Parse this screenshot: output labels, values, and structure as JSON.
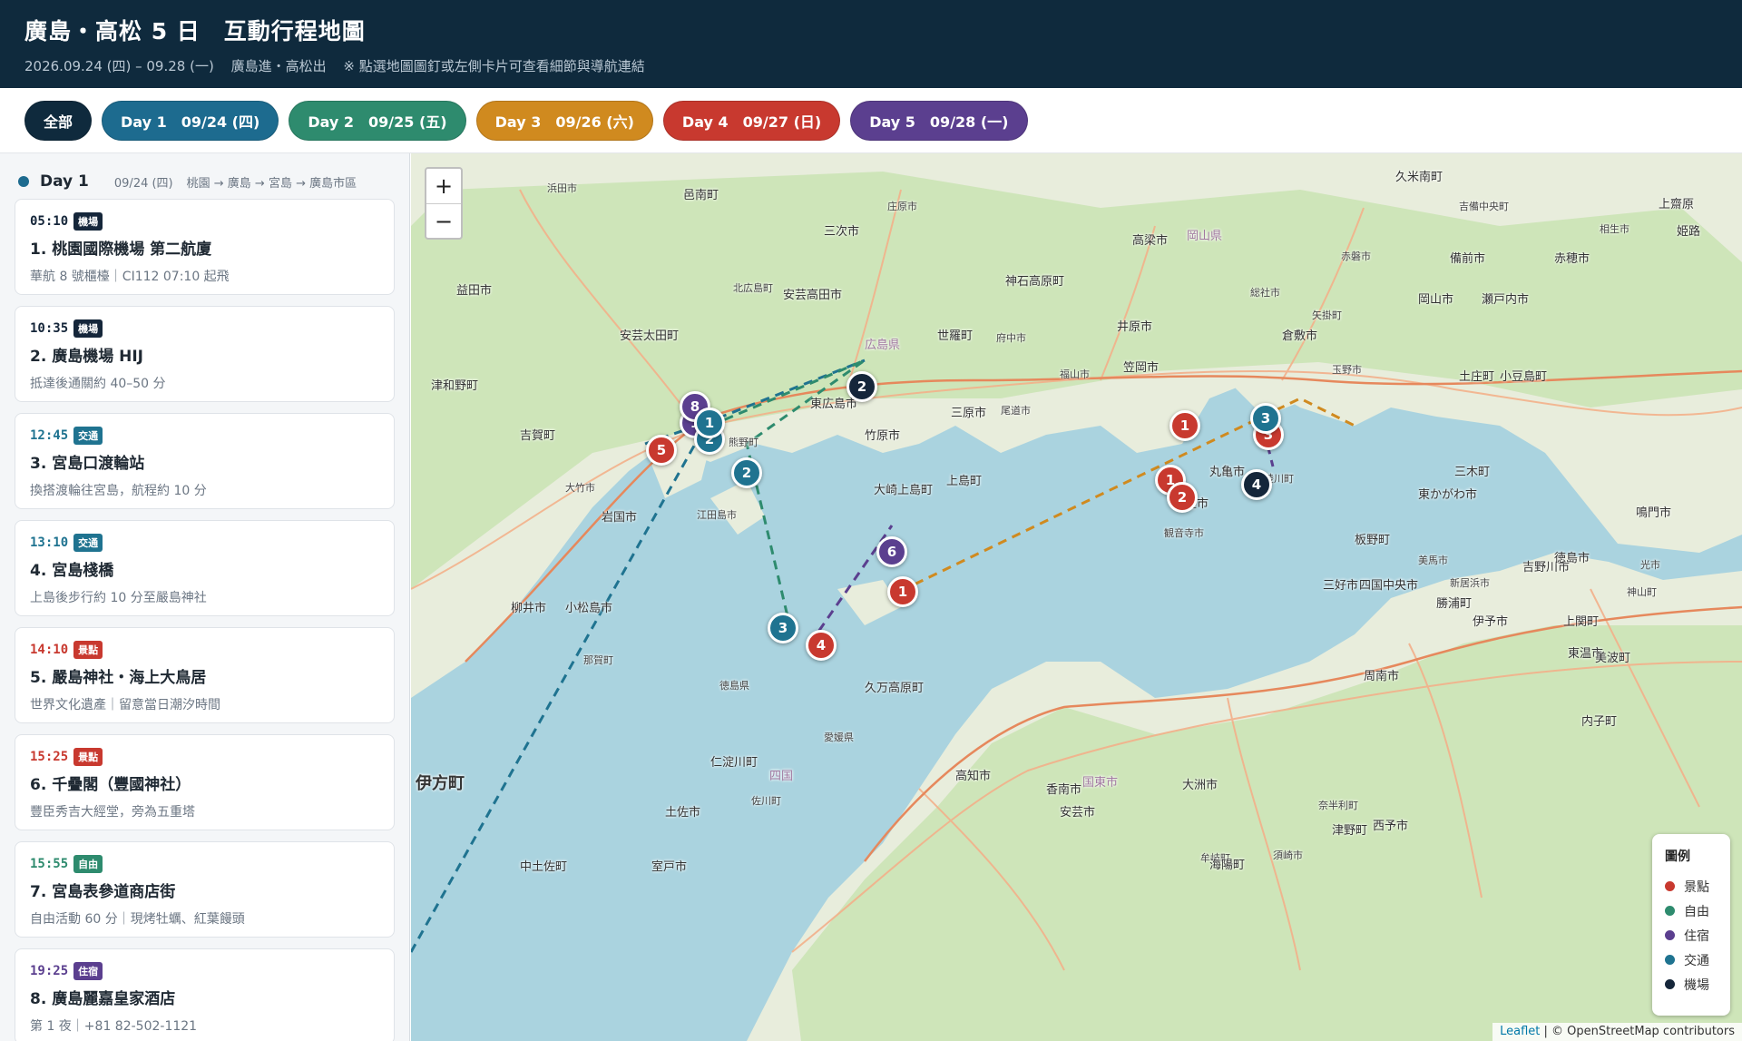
{
  "header": {
    "title": "廣島・高松 5 日　互動行程地圖",
    "dates": "2026.09.24 (四) – 09.28 (一)",
    "route": "廣島進・高松出",
    "hint": "※ 點選地圖圖釘或左側卡片可查看細節與導航連結"
  },
  "filters": [
    {
      "label": "全部",
      "color": "#0f2a3d"
    },
    {
      "label": "Day 1　09/24 (四)",
      "color": "#1d6b8f"
    },
    {
      "label": "Day 2　09/25 (五)",
      "color": "#2e8b6e"
    },
    {
      "label": "Day 3　09/26 (六)",
      "color": "#d08a1f"
    },
    {
      "label": "Day 4　09/27 (日)",
      "color": "#c8392f"
    },
    {
      "label": "Day 5　09/28 (一)",
      "color": "#5b3f8f"
    }
  ],
  "sidebar": {
    "day": {
      "name": "Day 1",
      "date": "09/24 (四)",
      "route": "桃園 → 廣島 → 宮島 → 廣島市區",
      "color": "#1d6b8f"
    },
    "items": [
      {
        "time": "05:10",
        "badge": "機場",
        "title": "1. 桃園國際機場 第二航廈",
        "note": "華航 8 號櫃檯｜CI112 07:10 起飛",
        "color": "#15263a"
      },
      {
        "time": "10:35",
        "badge": "機場",
        "title": "2. 廣島機場 HIJ",
        "note": "抵達後通關約 40–50 分",
        "color": "#15263a"
      },
      {
        "time": "12:45",
        "badge": "交通",
        "title": "3. 宮島口渡輪站",
        "note": "換搭渡輪往宮島，航程約 10 分",
        "color": "#1f7390"
      },
      {
        "time": "13:10",
        "badge": "交通",
        "title": "4. 宮島棧橋",
        "note": "上島後步行約 10 分至嚴島神社",
        "color": "#1f7390"
      },
      {
        "time": "14:10",
        "badge": "景點",
        "title": "5. 嚴島神社・海上大鳥居",
        "note": "世界文化遺產｜留意當日潮汐時間",
        "color": "#c8392f"
      },
      {
        "time": "15:25",
        "badge": "景點",
        "title": "6. 千疊閣（豐國神社）",
        "note": "豐臣秀吉大經堂，旁為五重塔",
        "color": "#c8392f"
      },
      {
        "time": "15:55",
        "badge": "自由",
        "title": "7. 宮島表參道商店街",
        "note": "自由活動 60 分｜現烤牡蠣、紅葉饅頭",
        "color": "#2e8b6e"
      },
      {
        "time": "19:25",
        "badge": "住宿",
        "title": "8. 廣島麗嘉皇家酒店",
        "note": "第 1 夜｜+81 82-502-1121",
        "color": "#5b3f8f"
      }
    ]
  },
  "map": {
    "zoom_in": "+",
    "zoom_out": "−",
    "places": [
      "浜田市",
      "邑南町",
      "三次市",
      "庄原市",
      "久米南町",
      "上齋原",
      "吉備中央町",
      "岡山県",
      "高梁市",
      "赤磐市",
      "備前市",
      "赤穂市",
      "相生市",
      "姫路",
      "益田市",
      "北広島町",
      "安芸高田市",
      "神石高原町",
      "総社市",
      "岡山市",
      "瀬戸内市",
      "矢掛町",
      "安芸太田町",
      "世羅町",
      "府中市",
      "井原市",
      "倉敷市",
      "広島県",
      "津和野町",
      "笠岡市",
      "玉野市",
      "土庄町",
      "小豆島町",
      "福山市",
      "東広島市",
      "三原市",
      "尾道市",
      "竹原市",
      "吉賀町",
      "熊野町",
      "丸亀市",
      "三木町",
      "大竹市",
      "大崎上島町",
      "上島町",
      "綾川町",
      "東かがわ市",
      "岩国市",
      "江田島市",
      "三豊市",
      "鳴門市",
      "観音寺市",
      "板野町",
      "周南市",
      "新居浜市",
      "四国中央市",
      "三好市",
      "美馬市",
      "吉野川市",
      "徳島市",
      "光市",
      "柳井市",
      "小松島市",
      "神山町",
      "勝浦町",
      "上関町",
      "那賀町",
      "伊予市",
      "東温市",
      "徳島県",
      "久万高原町",
      "美波町",
      "愛媛県",
      "内子町",
      "仁淀川町",
      "四国",
      "高知市",
      "香南市",
      "国東市",
      "大洲市",
      "伊方町",
      "佐川町",
      "土佐市",
      "安芸市",
      "奈半利町",
      "西予市",
      "津野町",
      "須崎市",
      "中土佐町",
      "室戸市",
      "牟岐町",
      "海陽町"
    ],
    "markers": [
      "1",
      "2",
      "5",
      "8",
      "1",
      "2",
      "3",
      "4",
      "2",
      "6",
      "1",
      "1",
      "1",
      "2",
      "3",
      "4",
      "3"
    ],
    "legend": {
      "title": "圖例",
      "items": [
        {
          "label": "景點",
          "color": "#c8392f"
        },
        {
          "label": "自由",
          "color": "#2e8b6e"
        },
        {
          "label": "住宿",
          "color": "#5b3f8f"
        },
        {
          "label": "交通",
          "color": "#1f7390"
        },
        {
          "label": "機場",
          "color": "#15263a"
        }
      ]
    },
    "attribution": {
      "leaflet": "Leaflet",
      "osm": "| © OpenStreetMap contributors"
    }
  }
}
